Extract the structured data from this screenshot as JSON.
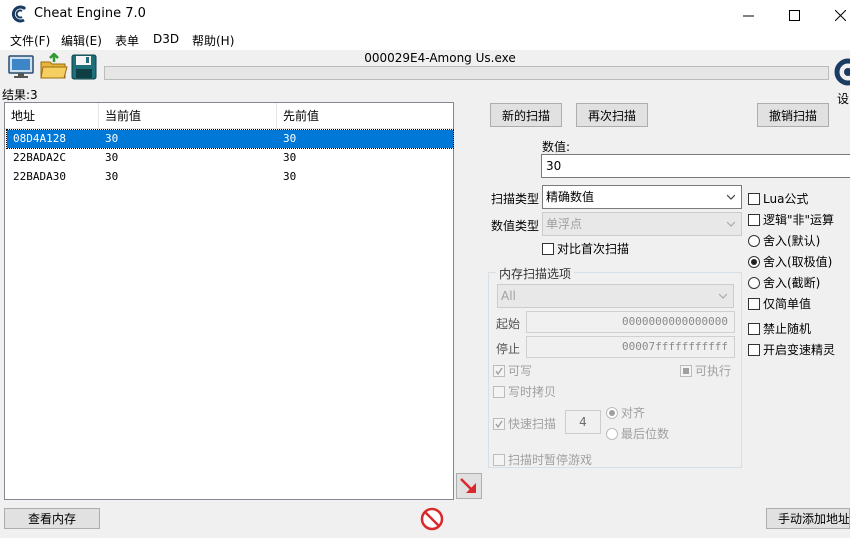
{
  "window": {
    "title": "Cheat Engine 7.0"
  },
  "menu": {
    "file": "文件(F)",
    "edit": "编辑(E)",
    "table": "表单",
    "d3d": "D3D",
    "help": "帮助(H)"
  },
  "toolbar": {
    "process_name": "000029E4-Among Us.exe",
    "settings_label": "设"
  },
  "results": {
    "label": "结果:3",
    "columns": {
      "address": "地址",
      "current": "当前值",
      "previous": "先前值"
    },
    "rows": [
      {
        "address": "08D4A128",
        "current": "30",
        "previous": "30"
      },
      {
        "address": "22BADA2C",
        "current": "30",
        "previous": "30"
      },
      {
        "address": "22BADA30",
        "current": "30",
        "previous": "30"
      }
    ]
  },
  "scan": {
    "new_scan": "新的扫描",
    "next_scan": "再次扫描",
    "undo_scan": "撤销扫描",
    "value_label": "数值:",
    "value": "30",
    "scan_type_label": "扫描类型",
    "scan_type_value": "精确数值",
    "value_type_label": "数值类型",
    "value_type_value": "单浮点",
    "compare_first": "对比首次扫描"
  },
  "memory_options": {
    "title": "内存扫描选项",
    "region": "All",
    "start_label": "起始",
    "start_value": "0000000000000000",
    "stop_label": "停止",
    "stop_value": "00007fffffffffff",
    "writable": "可写",
    "executable": "可执行",
    "copy_on_write": "写时拷贝",
    "fast_scan": "快速扫描",
    "fast_scan_digits": "4",
    "align": "对齐",
    "last_digits": "最后位数",
    "pause_game": "扫描时暂停游戏"
  },
  "options": {
    "lua": "Lua公式",
    "not_logic": "逻辑\"非\"运算",
    "round_default": "舍入(默认)",
    "round_extreme": "舍入(取极值)",
    "truncate": "舍入(截断)",
    "simple_only": "仅简单值",
    "no_random": "禁止随机",
    "speedhack": "开启变速精灵"
  },
  "footer": {
    "view_memory": "查看内存",
    "add_address": "手动添加地址"
  },
  "colors": {
    "selection": "#0078d7",
    "accent_red": "#d9292b"
  }
}
